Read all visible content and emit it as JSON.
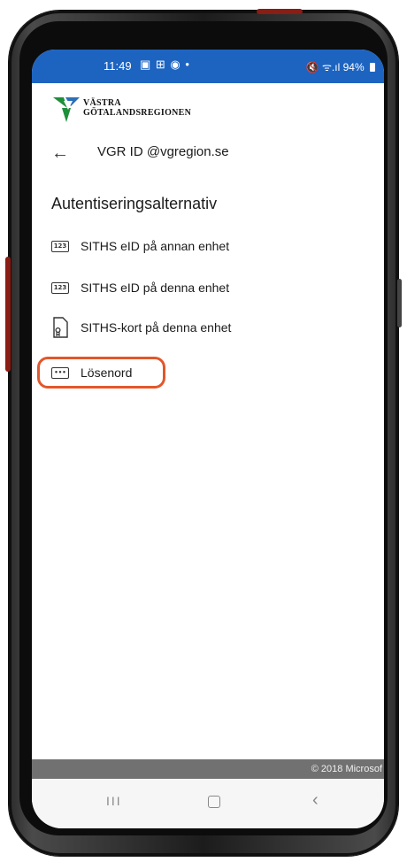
{
  "status_bar": {
    "time": "11:49",
    "left_icons": "▣ ⊞ ◉ •",
    "right_icons": "🔇 ᯤ.ıl",
    "battery": "94%"
  },
  "logo": {
    "line1": "VÄSTRA",
    "line2": "GÖTALANDSREGIONEN",
    "brand_green": "#1e8f3a",
    "brand_blue": "#2b6fb6"
  },
  "account": {
    "back_icon": "←",
    "name": "VGR ID @vgregion.se"
  },
  "section_title": "Autentiseringsalternativ",
  "options": [
    {
      "icon": "123",
      "label": "SITHS eID på annan enhet"
    },
    {
      "icon": "123",
      "label": "SITHS eID på denna enhet"
    },
    {
      "icon": "card-icon",
      "label": "SITHS-kort på denna enhet"
    },
    {
      "icon": "•••",
      "label": "Lösenord"
    }
  ],
  "footer": {
    "copyright": "© 2018 Microsof"
  },
  "nav": {
    "recent": "III",
    "back": "‹"
  },
  "colors": {
    "status_bar": "#1d64c1",
    "highlight": "#e2572b"
  }
}
